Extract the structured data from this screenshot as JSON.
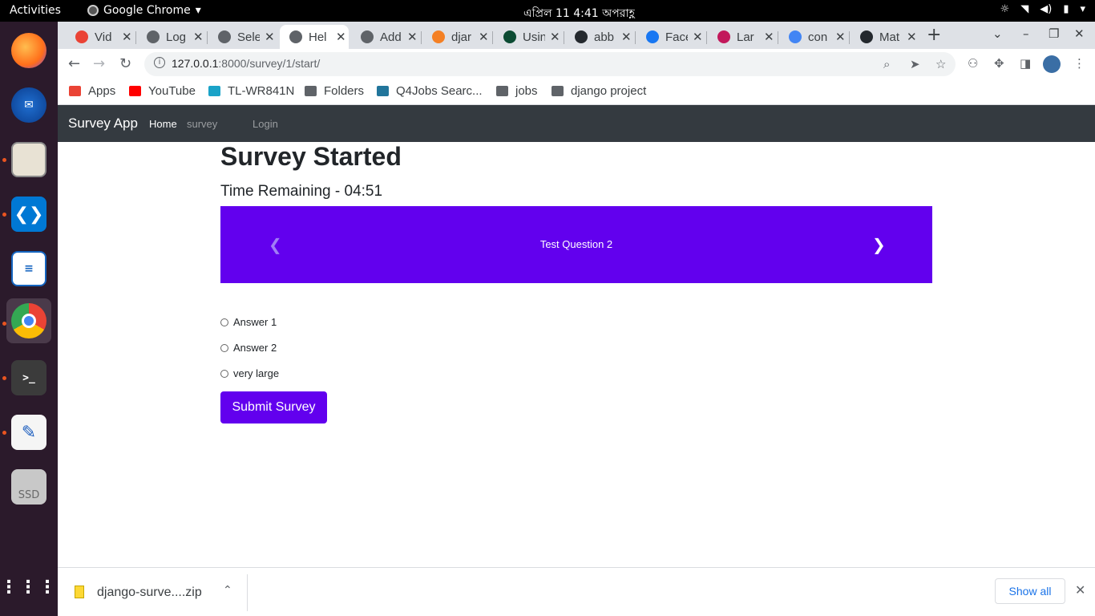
{
  "os": {
    "activities": "Activities",
    "app_name": "Google Chrome",
    "clock": "এপ্রিল 11  4:41 অপরাহ্ণ"
  },
  "tabs": [
    {
      "title": "Vid",
      "color": "#ea4335"
    },
    {
      "title": "Log",
      "color": "#5f6368"
    },
    {
      "title": "Sele",
      "color": "#5f6368"
    },
    {
      "title": "Hel",
      "color": "#5f6368"
    },
    {
      "title": "Add",
      "color": "#5f6368"
    },
    {
      "title": "djar",
      "color": "#f48024"
    },
    {
      "title": "Usin",
      "color": "#0c4b33"
    },
    {
      "title": "abb",
      "color": "#24292e"
    },
    {
      "title": "Face",
      "color": "#1877f2"
    },
    {
      "title": "Lar",
      "color": "#c2185b"
    },
    {
      "title": "con",
      "color": "#4285f4"
    },
    {
      "title": "Mat",
      "color": "#24292e"
    }
  ],
  "active_tab": 3,
  "omnibox": {
    "host": "127.0.0.1",
    "path": ":8000/survey/1/start/"
  },
  "bookmarks": [
    {
      "label": "Apps",
      "color": "#ea4335"
    },
    {
      "label": "YouTube",
      "color": "#ff0000"
    },
    {
      "label": "TL-WR841N",
      "color": "#1aa3c8"
    },
    {
      "label": "Folders",
      "color": "#5f6368"
    },
    {
      "label": "Q4Jobs Searc...",
      "color": "#21759b"
    },
    {
      "label": "jobs",
      "color": "#5f6368"
    },
    {
      "label": "django project",
      "color": "#5f6368"
    }
  ],
  "navbar": {
    "brand": "Survey App",
    "home": "Home",
    "survey": "survey",
    "login": "Login"
  },
  "survey": {
    "title": "Survey Started",
    "timer": "Time Remaining - 04:51",
    "question": "Test Question 2",
    "answers": [
      "Answer 1",
      "Answer 2",
      "very large"
    ],
    "submit_label": "Submit Survey",
    "accent": "#6200ee"
  },
  "download": {
    "filename": "django-surve....zip",
    "show_all": "Show all"
  }
}
